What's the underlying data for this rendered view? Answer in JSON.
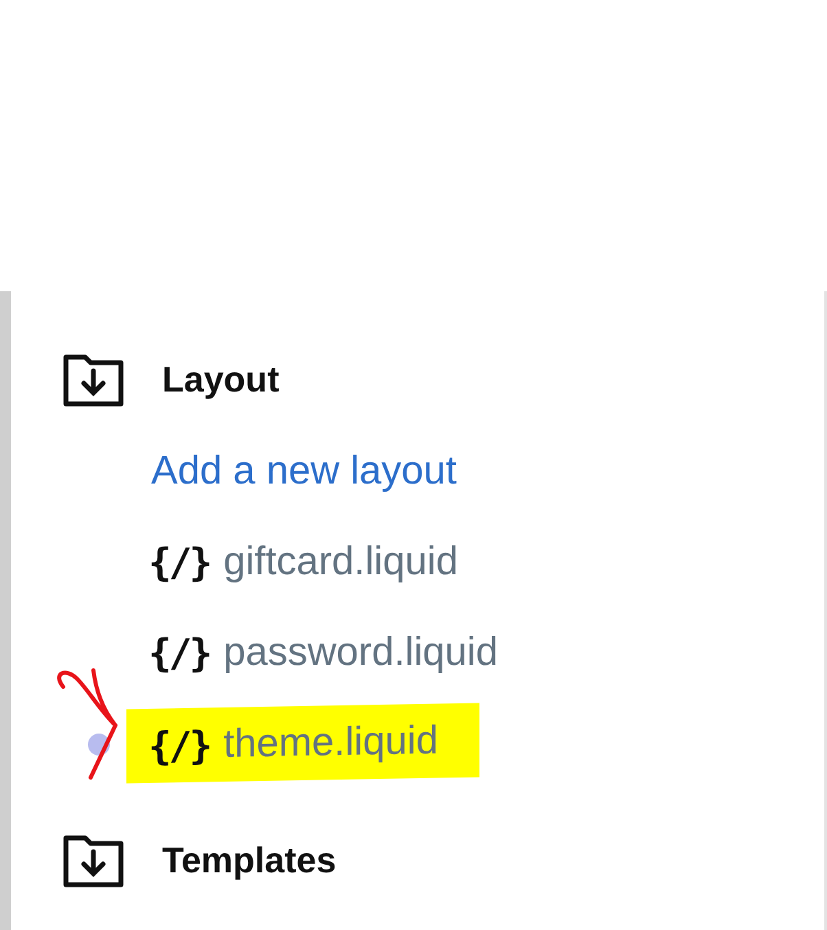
{
  "sections": [
    {
      "title": "Layout",
      "add_link": "Add a new layout",
      "items": [
        {
          "icon": "{/}",
          "name": "giftcard.liquid",
          "highlighted": false,
          "dot": false
        },
        {
          "icon": "{/}",
          "name": "password.liquid",
          "highlighted": false,
          "dot": false
        },
        {
          "icon": "{/}",
          "name": "theme.liquid",
          "highlighted": true,
          "dot": true
        }
      ]
    },
    {
      "title": "Templates"
    }
  ]
}
